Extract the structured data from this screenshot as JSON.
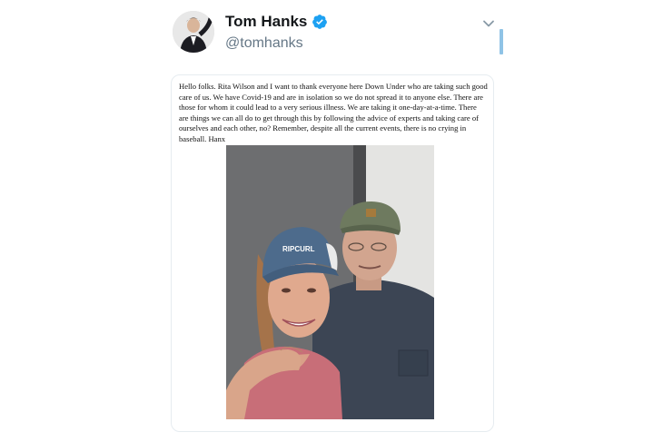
{
  "tweet": {
    "display_name": "Tom Hanks",
    "handle": "@tomhanks",
    "note_text": "Hello folks. Rita Wilson and I want to thank everyone here Down Under who are taking such good care of us. We have Covid-19 and are in isolation so we do not spread it to anyone else. There are those for whom it could lead to a very serious illness. We are taking it one-day-at-a-time. There are things we can all do to get through this by following the advice of experts and taking care of ourselves and each other, no? Remember, despite all the current events, there is no crying in baseball. Hanx",
    "cap_logo_text": "RIPCURL"
  },
  "icons": {
    "verified": "verified-badge-icon",
    "menu": "chevron-down-icon"
  },
  "colors": {
    "verified_blue": "#1da1f2",
    "handle_gray": "#657786",
    "card_border": "#e6ecf0"
  }
}
